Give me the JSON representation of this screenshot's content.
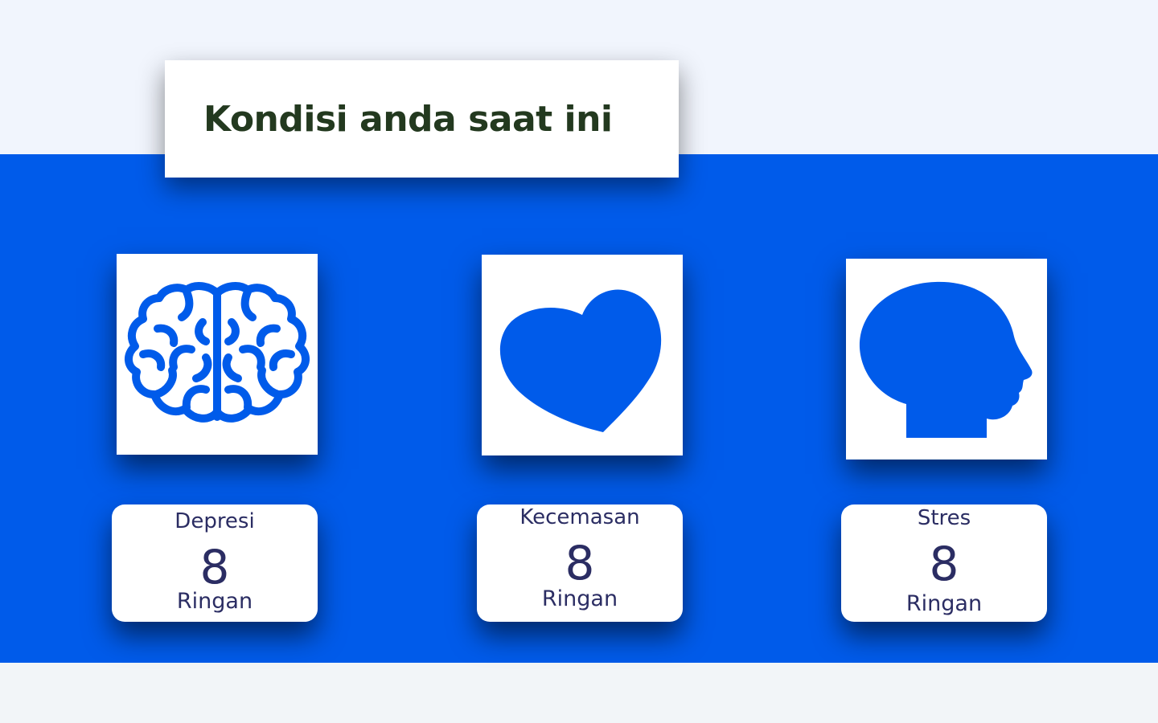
{
  "header": {
    "title": "Kondisi anda saat ini"
  },
  "colors": {
    "accent_blue": "#005bea",
    "title_green": "#23391f",
    "card_text": "#2b2d63"
  },
  "cards": [
    {
      "icon": "brain-icon",
      "label": "Depresi",
      "score": "8",
      "level": "Ringan"
    },
    {
      "icon": "heart-icon",
      "label": "Kecemasan",
      "score": "8",
      "level": "Ringan"
    },
    {
      "icon": "head-icon",
      "label": "Stres",
      "score": "8",
      "level": "Ringan"
    }
  ]
}
